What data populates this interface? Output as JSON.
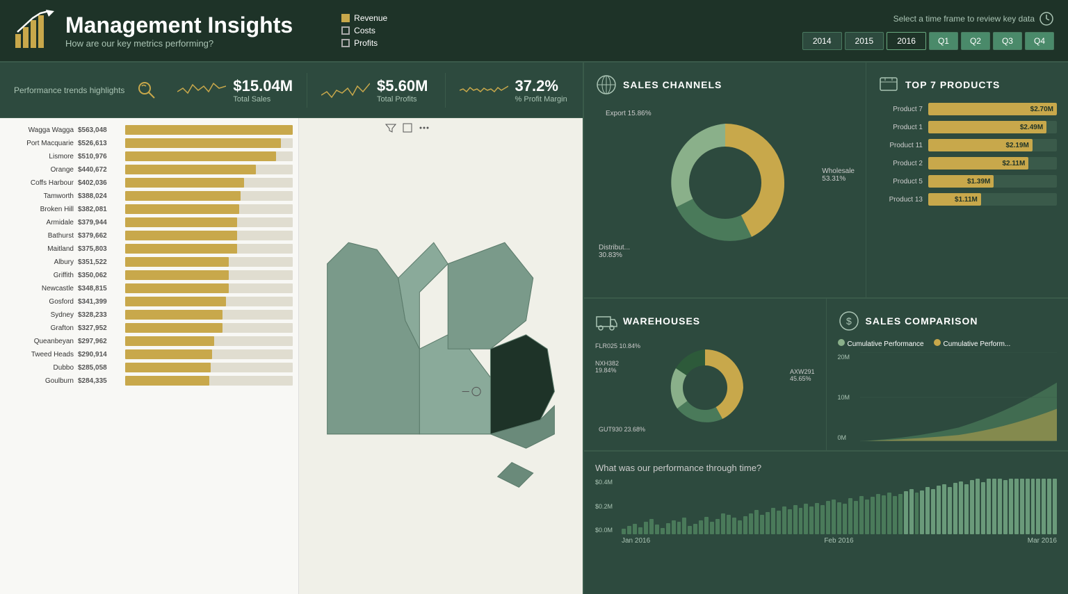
{
  "header": {
    "title": "Management Insights",
    "subtitle": "How are our key metrics performing?",
    "legend": [
      {
        "label": "Revenue",
        "type": "revenue"
      },
      {
        "label": "Costs",
        "type": "costs"
      },
      {
        "label": "Profits",
        "type": "profits"
      }
    ],
    "time_label": "Select a time frame to review key data",
    "years": [
      "2014",
      "2015",
      "2016"
    ],
    "active_year": "2016",
    "quarters": [
      "Q1",
      "Q2",
      "Q3",
      "Q4"
    ],
    "active_quarter": "Q1"
  },
  "kpi": {
    "trends_label": "Performance trends highlights",
    "metrics": [
      {
        "value": "$15.04M",
        "label": "Total Sales"
      },
      {
        "value": "$5.60M",
        "label": "Total Profits"
      },
      {
        "value": "37.2%",
        "label": "% Profit Margin"
      }
    ]
  },
  "bar_chart": {
    "cities": [
      {
        "name": "Wagga Wagga",
        "value": "$563,048",
        "pct": 100
      },
      {
        "name": "Port Macquarie",
        "value": "$526,613",
        "pct": 93
      },
      {
        "name": "Lismore",
        "value": "$510,976",
        "pct": 90
      },
      {
        "name": "Orange",
        "value": "$440,672",
        "pct": 78
      },
      {
        "name": "Coffs Harbour",
        "value": "$402,036",
        "pct": 71
      },
      {
        "name": "Tamworth",
        "value": "$388,024",
        "pct": 69
      },
      {
        "name": "Broken Hill",
        "value": "$382,081",
        "pct": 68
      },
      {
        "name": "Armidale",
        "value": "$379,944",
        "pct": 67
      },
      {
        "name": "Bathurst",
        "value": "$379,662",
        "pct": 67
      },
      {
        "name": "Maitland",
        "value": "$375,803",
        "pct": 67
      },
      {
        "name": "Albury",
        "value": "$351,522",
        "pct": 62
      },
      {
        "name": "Griffith",
        "value": "$350,062",
        "pct": 62
      },
      {
        "name": "Newcastle",
        "value": "$348,815",
        "pct": 62
      },
      {
        "name": "Gosford",
        "value": "$341,399",
        "pct": 60
      },
      {
        "name": "Sydney",
        "value": "$328,233",
        "pct": 58
      },
      {
        "name": "Grafton",
        "value": "$327,952",
        "pct": 58
      },
      {
        "name": "Queanbeyan",
        "value": "$297,962",
        "pct": 53
      },
      {
        "name": "Tweed Heads",
        "value": "$290,914",
        "pct": 52
      },
      {
        "name": "Dubbo",
        "value": "$285,058",
        "pct": 51
      },
      {
        "name": "Goulburn",
        "value": "$284,335",
        "pct": 50
      }
    ]
  },
  "sales_channels": {
    "title": "SALES CHANNELS",
    "segments": [
      {
        "label": "Export 15.86%",
        "pct": 15.86,
        "color": "#8ab08a"
      },
      {
        "label": "Wholesale 53.31%",
        "pct": 53.31,
        "color": "#c8a84b"
      },
      {
        "label": "Distribut... 30.83%",
        "pct": 30.83,
        "color": "#4a7a5a"
      }
    ]
  },
  "top7_products": {
    "title": "TOP 7 PRODUCTS",
    "products": [
      {
        "name": "Product 7",
        "value": "$2.70M",
        "pct": 100
      },
      {
        "name": "Product 1",
        "value": "$2.49M",
        "pct": 92
      },
      {
        "name": "Product 11",
        "value": "$2.19M",
        "pct": 81
      },
      {
        "name": "Product 2",
        "value": "$2.11M",
        "pct": 78
      },
      {
        "name": "Product 5",
        "value": "$1.39M",
        "pct": 51
      },
      {
        "name": "Product 13",
        "value": "$1.11M",
        "pct": 41
      }
    ]
  },
  "warehouses": {
    "title": "WAREHOUSES",
    "segments": [
      {
        "label": "AXW291 45.65%",
        "pct": 45.65,
        "color": "#c8a84b"
      },
      {
        "label": "NXH382 19.84%",
        "pct": 19.84,
        "color": "#8ab08a"
      },
      {
        "label": "GUT930 23.68%",
        "pct": 23.68,
        "color": "#4a7a5a"
      },
      {
        "label": "FLR025 10.84%",
        "pct": 10.84,
        "color": "#2d5a3a"
      }
    ]
  },
  "sales_comparison": {
    "title": "SALES COMPARISON",
    "legend": [
      "Cumulative Performance",
      "Cumulative Perform..."
    ],
    "y_labels": [
      "20M",
      "10M",
      "0M"
    ]
  },
  "performance": {
    "title": "What was our performance through time?",
    "y_labels": [
      "$0.4M",
      "$0.2M",
      "$0.0M"
    ],
    "x_labels": [
      "Jan 2016",
      "Feb 2016",
      "Mar 2016"
    ]
  }
}
